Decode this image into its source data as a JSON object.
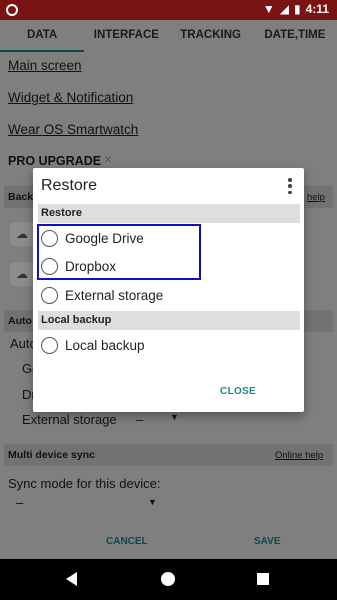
{
  "status_bar": {
    "time": "4:11"
  },
  "tabs": [
    "DATA",
    "INTERFACE",
    "TRACKING",
    "DATE,TIME"
  ],
  "background": {
    "links": [
      "Main screen",
      "Widget & Notification",
      "Wear OS Smartwatch"
    ],
    "pro_upgrade": "PRO UPGRADE",
    "pro_close": "×",
    "backup_section_prefix": "Back",
    "backup_help_suffix": "help",
    "auto_prefix": "Auto",
    "auto_sub_prefix": "Auto",
    "go_prefix": "Go",
    "dr_prefix": "Dr",
    "external_storage": "External storage",
    "dash": "–",
    "multi_device_sync": "Multi device sync",
    "online_help": "Online help",
    "sync_mode_label": "Sync mode for this device:",
    "sync_value": "–",
    "cancel": "CANCEL",
    "save": "SAVE"
  },
  "dialog": {
    "title": "Restore",
    "sections": [
      {
        "header": "Restore",
        "options": [
          "Google Drive",
          "Dropbox",
          "External storage"
        ]
      },
      {
        "header": "Local backup",
        "options": [
          "Local backup"
        ]
      }
    ],
    "close_label": "CLOSE"
  },
  "colors": {
    "status_bar": "#7a1414",
    "accent": "#1e8b85",
    "highlight": "#1010c8"
  }
}
